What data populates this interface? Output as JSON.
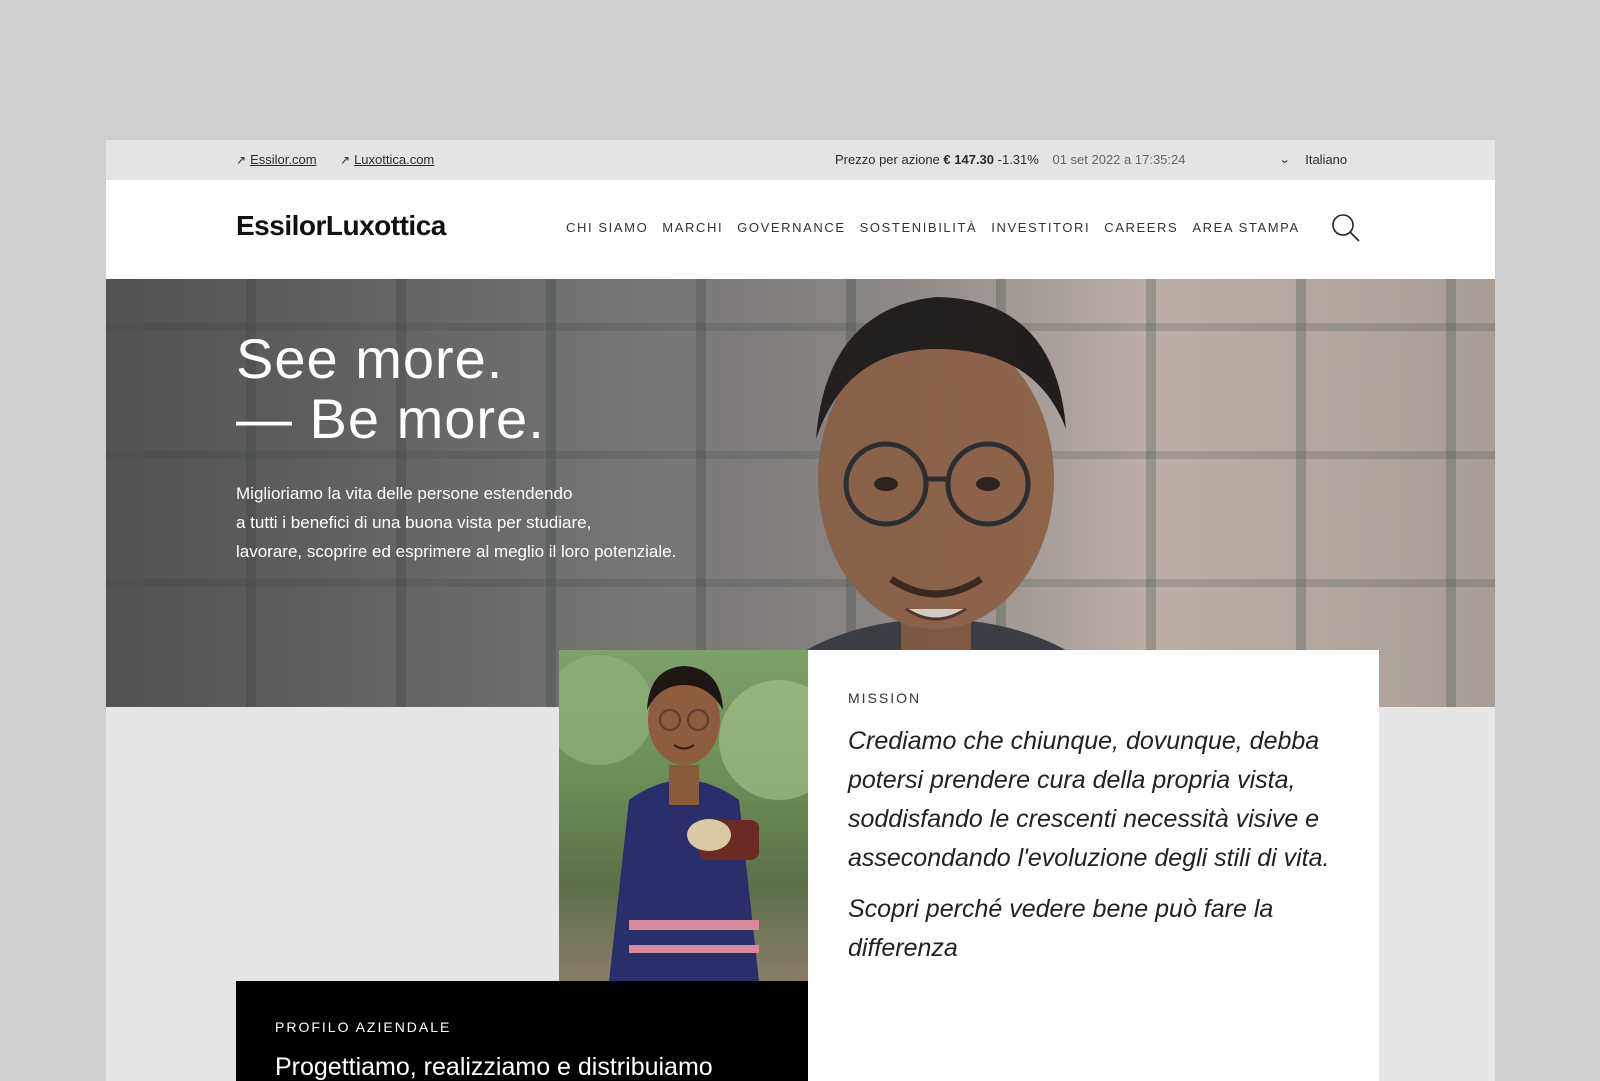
{
  "utility": {
    "links": [
      "Essilor.com",
      "Luxottica.com"
    ],
    "stock_label": "Prezzo per azione",
    "stock_price": "€ 147.30",
    "stock_change": "-1.31%",
    "stock_timestamp": "01 set 2022 a 17:35:24",
    "language": "Italiano"
  },
  "header": {
    "logo": "EssilorLuxottica",
    "nav": [
      "CHI SIAMO",
      "MARCHI",
      "GOVERNANCE",
      "SOSTENIBILITÀ",
      "INVESTITORI",
      "CAREERS",
      "AREA STAMPA"
    ]
  },
  "hero": {
    "title_line1": "See more.",
    "title_line2": "— Be more.",
    "text_line1": "Miglioriamo la vita delle persone estendendo",
    "text_line2": "a tutti i benefici di una buona vista per studiare,",
    "text_line3": "lavorare, scoprire ed esprimere al meglio il loro potenziale."
  },
  "mission": {
    "eyebrow": "MISSION",
    "quote": "Crediamo che chiunque, dovunque, debba potersi prendere cura della propria vista, soddisfando le crescenti necessità visive e assecondando l'evoluzione degli stili di vita.",
    "cta": "Scopri perché vedere bene può fare la differenza"
  },
  "profile": {
    "eyebrow": "PROFILO AZIENDALE",
    "heading": "Progettiamo, realizziamo e distribuiamo"
  },
  "colors": {
    "page_bg": "#cfcfcf",
    "utility_bg": "#e3e4e5",
    "header_bg": "#ffffff",
    "section_bg": "#e6e6e6",
    "profile_bg": "#000000"
  },
  "icons": [
    "arrow-up-right-icon",
    "chevron-down-icon",
    "search-icon"
  ]
}
